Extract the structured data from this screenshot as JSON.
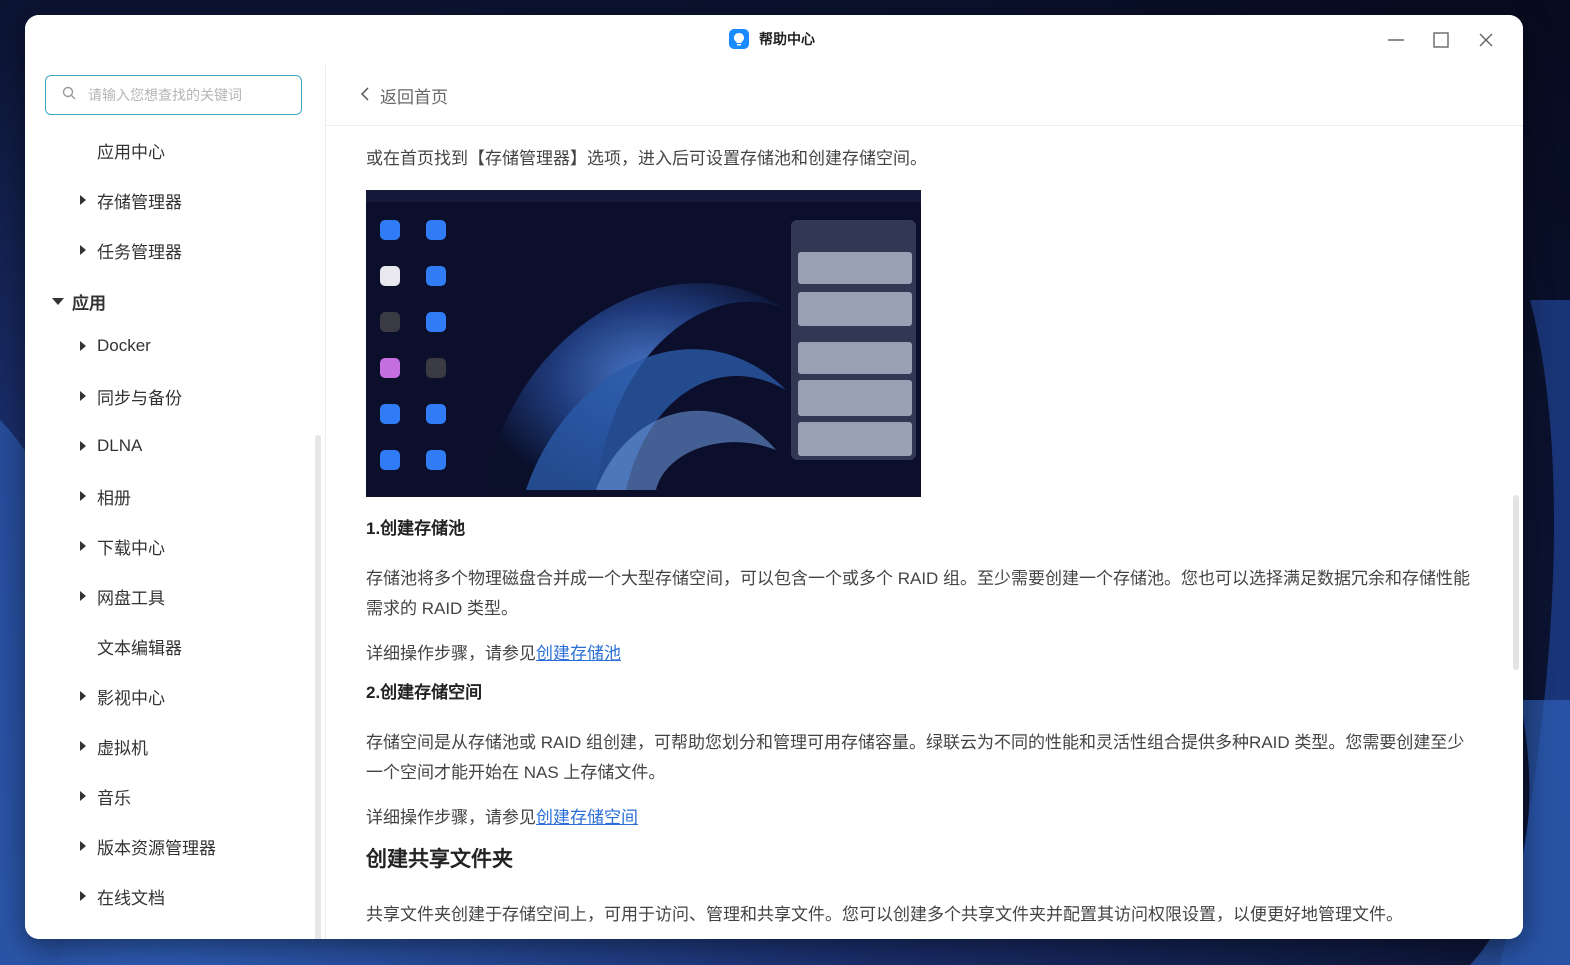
{
  "window": {
    "title": "帮助中心"
  },
  "search": {
    "placeholder": "请输入您想查找的关键词"
  },
  "sidebar": {
    "items": [
      {
        "label": "应用中心",
        "type": "plain"
      },
      {
        "label": "存储管理器",
        "type": "sub"
      },
      {
        "label": "任务管理器",
        "type": "sub"
      },
      {
        "label": "应用",
        "type": "group"
      },
      {
        "label": "Docker",
        "type": "sub"
      },
      {
        "label": "同步与备份",
        "type": "sub"
      },
      {
        "label": "DLNA",
        "type": "sub"
      },
      {
        "label": "相册",
        "type": "sub"
      },
      {
        "label": "下载中心",
        "type": "sub"
      },
      {
        "label": "网盘工具",
        "type": "sub"
      },
      {
        "label": "文本编辑器",
        "type": "plain"
      },
      {
        "label": "影视中心",
        "type": "sub"
      },
      {
        "label": "虚拟机",
        "type": "sub"
      },
      {
        "label": "音乐",
        "type": "sub"
      },
      {
        "label": "版本资源管理器",
        "type": "sub"
      },
      {
        "label": "在线文档",
        "type": "sub"
      }
    ]
  },
  "main": {
    "back_label": "返回首页",
    "intro": "或在首页找到【存储管理器】选项，进入后可设置存储池和创建存储空间。",
    "section1": {
      "heading": "1.创建存储池",
      "body": "存储池将多个物理磁盘合并成一个大型存储空间，可以包含一个或多个 RAID 组。至少需要创建一个存储池。您也可以选择满足数据冗余和存储性能需求的 RAID 类型。",
      "steps_prefix": "详细操作步骤，请参见",
      "steps_link": "创建存储池"
    },
    "section2": {
      "heading": "2.创建存储空间",
      "body": "存储空间是从存储池或 RAID 组创建，可帮助您划分和管理可用存储容量。绿联云为不同的性能和灵活性组合提供多种RAID 类型。您需要创建至少一个空间才能开始在 NAS 上存储文件。",
      "steps_prefix": "详细操作步骤，请参见",
      "steps_link": "创建存储空间"
    },
    "section3": {
      "heading": "创建共享文件夹",
      "body": "共享文件夹创建于存储空间上，可用于访问、管理和共享文件。您可以创建多个共享文件夹并配置其访问权限设置，以便更好地管理文件。"
    }
  },
  "colors": {
    "accent": "#2b6fd6",
    "search_border": "#3ba9c8",
    "app_icon": "#1a8cff"
  }
}
